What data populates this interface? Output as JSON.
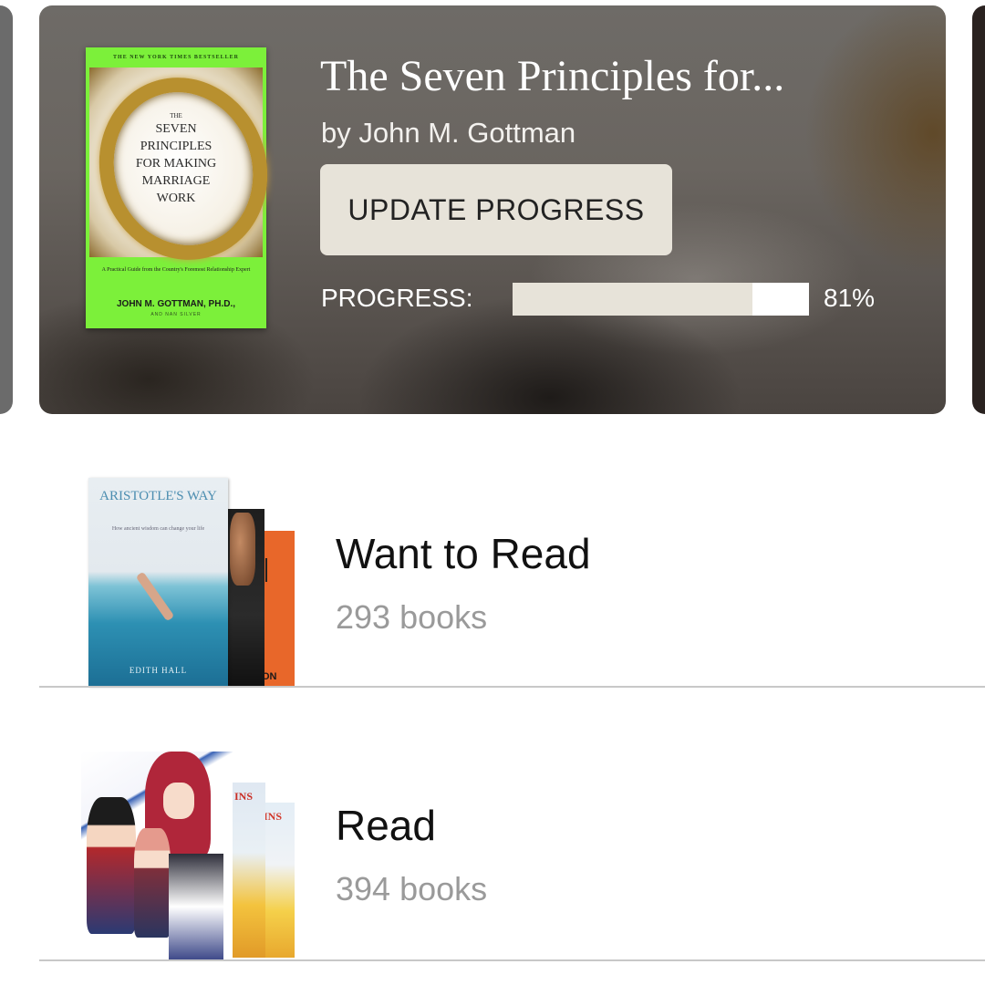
{
  "current_book": {
    "title": "The Seven Principles for...",
    "author": "by John M. Gottman",
    "update_button_label": "UPDATE PROGRESS",
    "progress_label": "PROGRESS:",
    "progress_percent_text": "81%",
    "progress_fraction": 0.81,
    "cover": {
      "banner": "THE NEW YORK TIMES BESTSELLER",
      "title_lines": [
        "THE",
        "SEVEN",
        "PRINCIPLES",
        "FOR MAKING",
        "MARRIAGE",
        "WORK"
      ],
      "subtitle": "A Practical Guide from the Country's Foremost Relationship Expert",
      "author": "JOHN M. GOTTMAN, PH.D.,",
      "coauthor": "AND NAN SILVER"
    }
  },
  "shelves": [
    {
      "name": "Want to Read",
      "count_text": "293 books",
      "cover_texts": {
        "title": "ARISTOTLE'S WAY",
        "subtitle": "How ancient wisdom can change your life",
        "author": "EDITH HALL",
        "back_cover_letters": "ON"
      }
    },
    {
      "name": "Read",
      "count_text": "394 books",
      "cover_texts": {
        "side_title": "INS"
      }
    }
  ],
  "colors": {
    "button_bg": "#e7e3d9",
    "progress_fill": "#e7e3d9",
    "progress_track": "#ffffff",
    "shelf_count": "#9a9a9a",
    "divider": "#c8c8c8"
  }
}
